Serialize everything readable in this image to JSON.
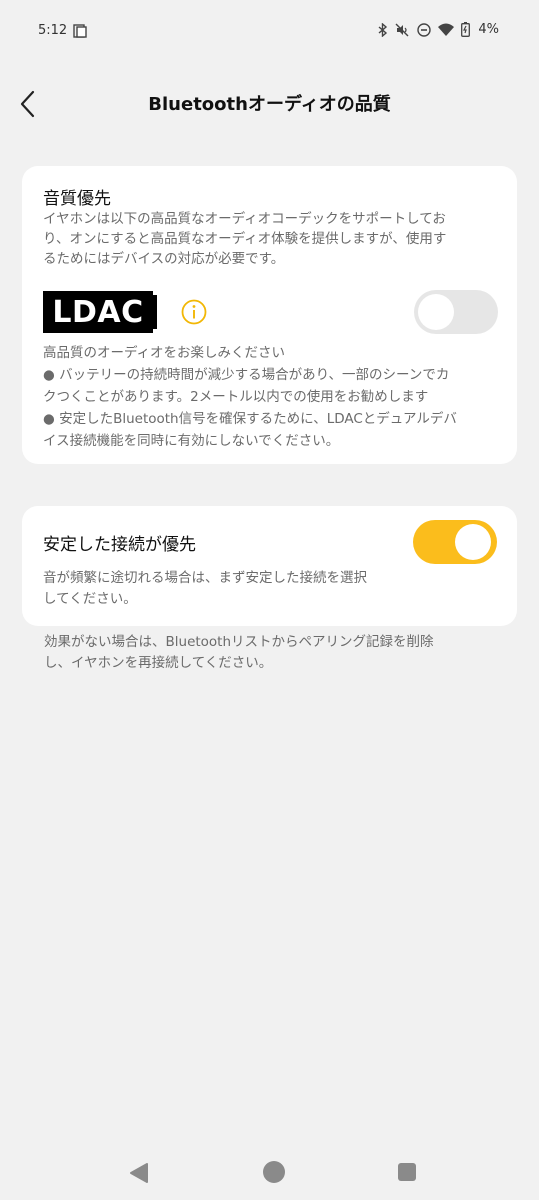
{
  "status_bar": {
    "time": "5:12",
    "battery": "4%",
    "icons": [
      "screenshot-icon",
      "bluetooth-icon",
      "mute-vibrate-icon",
      "do-not-disturb-icon",
      "wifi-icon",
      "battery-charging-icon"
    ]
  },
  "header": {
    "title": "Bluetoothオーディオの品質",
    "back_icon": "chevron-left-icon"
  },
  "quality_card": {
    "title": "音質優先",
    "description": [
      "イヤホンは以下の高品質なオーディオコーデックをサポートしてお",
      "り、オンにすると高品質なオーディオ体験を提供しますが、使用す",
      "るためにはデバイスの対応が必要です。"
    ],
    "codec_logo": "LDAC",
    "info_icon": "info-icon",
    "toggle_state": "off",
    "notes": [
      "高品質のオーディオをお楽しみください",
      "● バッテリーの持続時間が減少する場合があり、一部のシーンでカ",
      "クつくことがあります。2メートル以内での使用をお勧めします",
      "● 安定したBluetooth信号を確保するために、LDACとデュアルデバ",
      "イス接続機能を同時に有効にしないでください。"
    ]
  },
  "stable_card": {
    "title": "安定した接続が優先",
    "description": [
      "音が頻繁に途切れる場合は、まず安定した接続を選択",
      "してください。"
    ],
    "toggle_state": "on"
  },
  "footer_note": [
    "効果がない場合は、Bluetoothリストからペアリング記録を削除",
    "し、イヤホンを再接続してください。"
  ],
  "colors": {
    "accent": "#fbbd1c",
    "background": "#f1f1f1",
    "card": "#ffffff",
    "secondary_text": "#6b6b6b"
  },
  "nav_bar": {
    "icons": [
      "nav-back-icon",
      "nav-home-icon",
      "nav-recents-icon"
    ]
  }
}
